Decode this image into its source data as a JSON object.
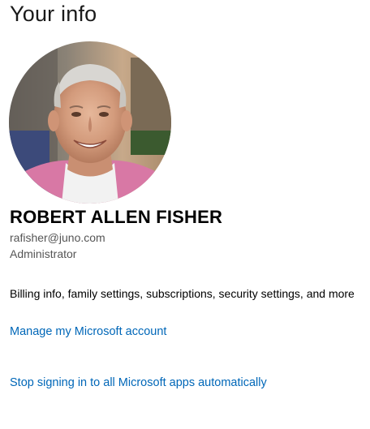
{
  "page": {
    "title": "Your info"
  },
  "profile": {
    "avatar_icon": "user-photo",
    "name": "ROBERT ALLEN FISHER",
    "email": "rafisher@juno.com",
    "role": "Administrator"
  },
  "account": {
    "description": "Billing info, family settings, subscriptions, security settings, and more",
    "manage_link": "Manage my Microsoft account",
    "stop_signin_link": "Stop signing in to all Microsoft apps automatically"
  },
  "colors": {
    "link": "#0067b8",
    "secondary_text": "#555555"
  }
}
